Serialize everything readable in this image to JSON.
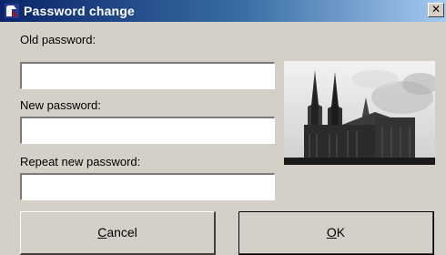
{
  "window": {
    "title": "Password change",
    "close_glyph": "✕",
    "app_icon": "password-app-icon"
  },
  "form": {
    "old_password_label": "Old password:",
    "new_password_label": "New password:",
    "repeat_password_label": "Repeat new password:",
    "old_password_value": "",
    "new_password_value": "",
    "repeat_password_value": ""
  },
  "image": {
    "subject": "cathedral-photo"
  },
  "buttons": {
    "cancel_accel": "C",
    "cancel_rest": "ancel",
    "ok_accel": "O",
    "ok_rest": "K"
  }
}
